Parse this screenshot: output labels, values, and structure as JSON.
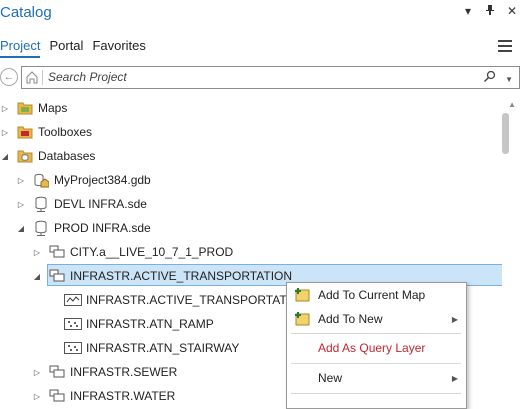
{
  "pane": {
    "title": "Catalog"
  },
  "title_controls": [
    "chevron-down-icon",
    "pin-icon",
    "close-icon"
  ],
  "tabs": [
    {
      "label": "Project",
      "active": true
    },
    {
      "label": "Portal",
      "active": false
    },
    {
      "label": "Favorites",
      "active": false
    }
  ],
  "search": {
    "placeholder": "Search Project"
  },
  "tree": [
    {
      "label": "Maps",
      "expanded": false,
      "icon": "maps-folder-icon",
      "level": 0
    },
    {
      "label": "Toolboxes",
      "expanded": false,
      "icon": "toolboxes-folder-icon",
      "level": 0
    },
    {
      "label": "Databases",
      "expanded": true,
      "icon": "databases-folder-icon",
      "level": 0
    },
    {
      "label": "MyProject384.gdb",
      "expanded": false,
      "icon": "geodatabase-home-icon",
      "level": 1
    },
    {
      "label": "DEVL INFRA.sde",
      "expanded": false,
      "icon": "database-connection-icon",
      "level": 1
    },
    {
      "label": "PROD INFRA.sde",
      "expanded": true,
      "icon": "database-connection-icon",
      "level": 1
    },
    {
      "label": "CITY.a__LIVE_10_7_1_PROD",
      "expanded": false,
      "icon": "feature-dataset-icon",
      "level": 2
    },
    {
      "label": "INFRASTR.ACTIVE_TRANSPORTATION",
      "expanded": true,
      "icon": "feature-dataset-icon",
      "level": 2,
      "selected": true
    },
    {
      "label": "INFRASTR.ACTIVE_TRANSPORTATION",
      "icon": "line-feature-class-icon",
      "level": 3
    },
    {
      "label": "INFRASTR.ATN_RAMP",
      "icon": "point-feature-class-icon",
      "level": 3
    },
    {
      "label": "INFRASTR.ATN_STAIRWAY",
      "icon": "point-feature-class-icon",
      "level": 3
    },
    {
      "label": "INFRASTR.SEWER",
      "expanded": false,
      "icon": "feature-dataset-icon",
      "level": 2
    },
    {
      "label": "INFRASTR.WATER",
      "expanded": false,
      "icon": "feature-dataset-icon",
      "level": 2
    }
  ],
  "context_menu": {
    "items": [
      {
        "label": "Add To Current Map",
        "icon": "add-to-map-icon",
        "submenu": false
      },
      {
        "label": "Add To New",
        "icon": "add-to-new-icon",
        "submenu": true
      },
      {
        "label": "Add As Query Layer",
        "icon": "",
        "submenu": false,
        "color": "#c4262e"
      },
      {
        "label": "New",
        "icon": "",
        "submenu": true
      }
    ]
  },
  "colors": {
    "accent": "#1f6fb5",
    "selection": "#cce4f7",
    "folder": "#e8b94a",
    "query_layer_text": "#c4262e"
  }
}
